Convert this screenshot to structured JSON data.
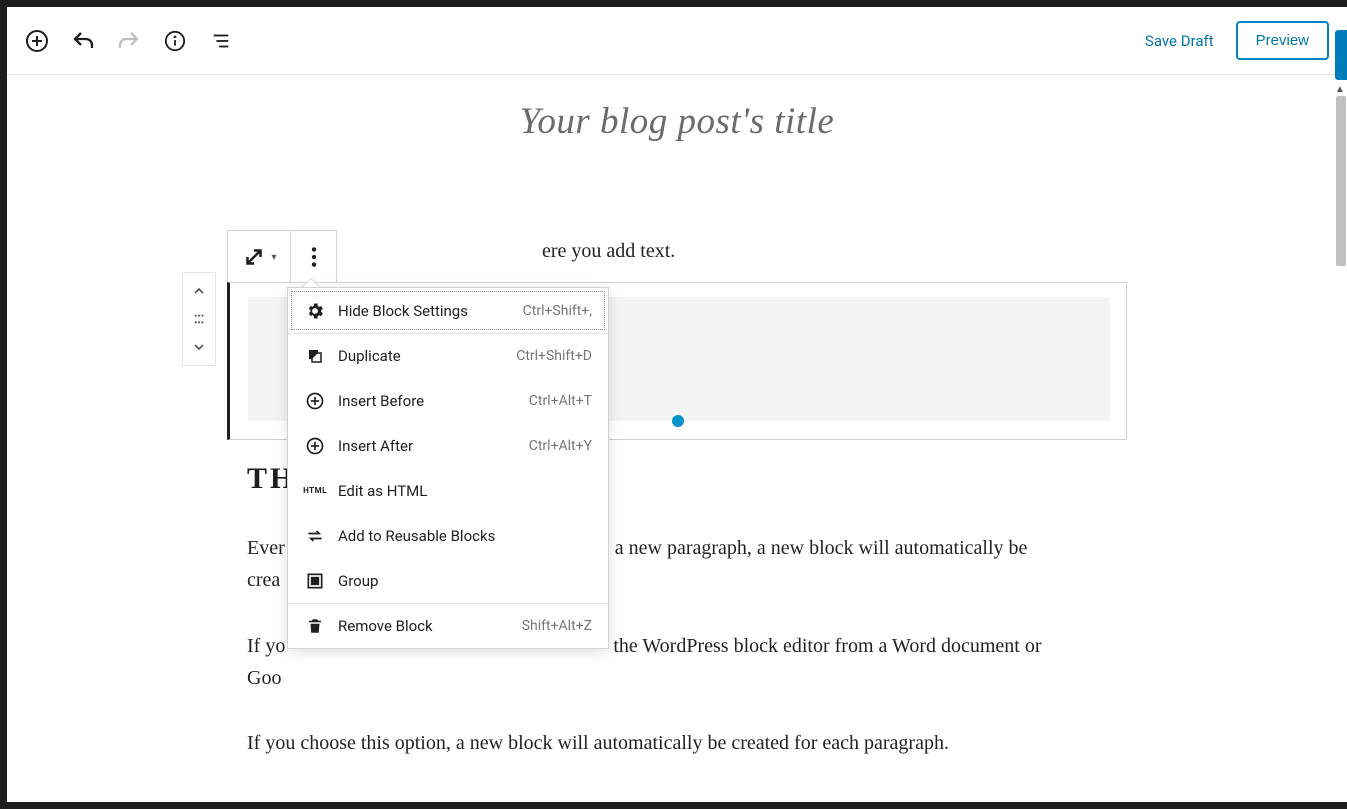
{
  "toolbar": {
    "save_draft": "Save Draft",
    "preview": "Preview"
  },
  "editor": {
    "title_placeholder": "Your blog post's title",
    "visible_fragment": "ere you add text.",
    "heading_fragment": "TH",
    "paragraphs": {
      "p1_a": "Ever",
      "p1_b": "a new paragraph, a new block will automatically be",
      "p1_c": "crea",
      "p2_a": "If yo",
      "p2_b": "the WordPress block editor from a Word document or",
      "p2_c": "Goo",
      "p3": "If you choose this option, a new block will automatically be created for each paragraph."
    }
  },
  "ctx_menu": [
    {
      "icon": "gear",
      "label": "Hide Block Settings",
      "shortcut": "Ctrl+Shift+,",
      "hl": true
    },
    {
      "icon": "dup",
      "label": "Duplicate",
      "shortcut": "Ctrl+Shift+D",
      "sep": true
    },
    {
      "icon": "ins-b",
      "label": "Insert Before",
      "shortcut": "Ctrl+Alt+T"
    },
    {
      "icon": "ins-a",
      "label": "Insert After",
      "shortcut": "Ctrl+Alt+Y"
    },
    {
      "icon": "html",
      "label": "Edit as HTML",
      "shortcut": ""
    },
    {
      "icon": "reuse",
      "label": "Add to Reusable Blocks",
      "shortcut": ""
    },
    {
      "icon": "group",
      "label": "Group",
      "shortcut": ""
    },
    {
      "icon": "trash",
      "label": "Remove Block",
      "shortcut": "Shift+Alt+Z",
      "sep": true
    }
  ]
}
